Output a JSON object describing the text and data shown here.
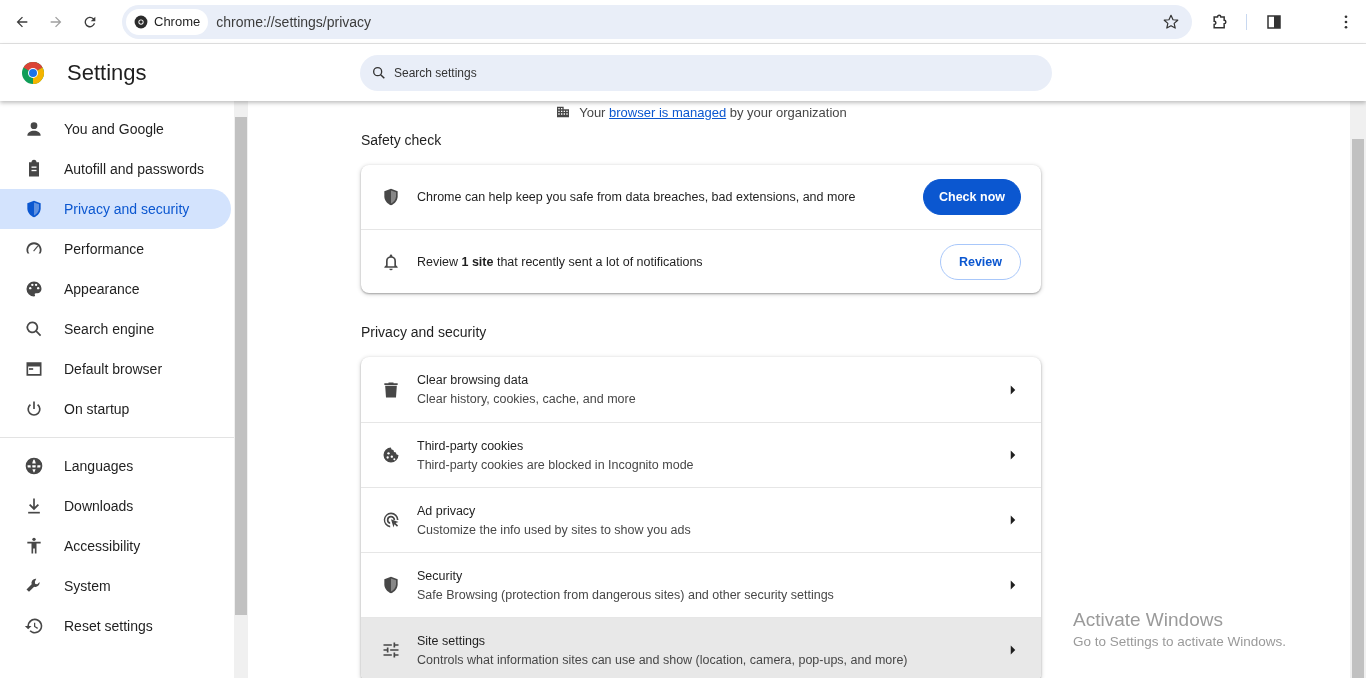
{
  "toolbar": {
    "chip": "Chrome",
    "url": "chrome://settings/privacy"
  },
  "header": {
    "title": "Settings",
    "search": {
      "placeholder": "Search settings"
    }
  },
  "sidebar": {
    "groups": [
      [
        {
          "label": "You and Google",
          "selected": false
        },
        {
          "label": "Autofill and passwords",
          "selected": false
        },
        {
          "label": "Privacy and security",
          "selected": true
        },
        {
          "label": "Performance",
          "selected": false
        },
        {
          "label": "Appearance",
          "selected": false
        },
        {
          "label": "Search engine",
          "selected": false
        },
        {
          "label": "Default browser",
          "selected": false
        },
        {
          "label": "On startup",
          "selected": false
        }
      ],
      [
        {
          "label": "Languages",
          "selected": false
        },
        {
          "label": "Downloads",
          "selected": false
        },
        {
          "label": "Accessibility",
          "selected": false
        },
        {
          "label": "System",
          "selected": false
        },
        {
          "label": "Reset settings",
          "selected": false
        }
      ]
    ]
  },
  "managed": {
    "before": "Your",
    "link": "browser is managed",
    "after": "by your organization"
  },
  "sections": [
    {
      "title": "Safety check",
      "rows": [
        {
          "kind": "button",
          "text": "Chrome can help keep you safe from data breaches, bad extensions, and more",
          "button": "Check now",
          "primary": true
        },
        {
          "kind": "button",
          "text": "Review **1 site** that recently sent a lot of notifications",
          "button": "Review",
          "primary": false
        }
      ]
    },
    {
      "title": "Privacy and security",
      "rows": [
        {
          "kind": "link",
          "title": "Clear browsing data",
          "subtitle": "Clear history, cookies, cache, and more",
          "hovered": false
        },
        {
          "kind": "link",
          "title": "Third-party cookies",
          "subtitle": "Third-party cookies are blocked in Incognito mode",
          "hovered": false
        },
        {
          "kind": "link",
          "title": "Ad privacy",
          "subtitle": "Customize the info used by sites to show you ads",
          "hovered": false
        },
        {
          "kind": "link",
          "title": "Security",
          "subtitle": "Safe Browsing (protection from dangerous sites) and other security settings",
          "hovered": false
        },
        {
          "kind": "link",
          "title": "Site settings",
          "subtitle": "Controls what information sites can use and show (location, camera, pop-ups, and more)",
          "hovered": true
        }
      ]
    }
  ],
  "activation": {
    "title": "Activate Windows",
    "subtitle": "Go to Settings to activate Windows."
  }
}
